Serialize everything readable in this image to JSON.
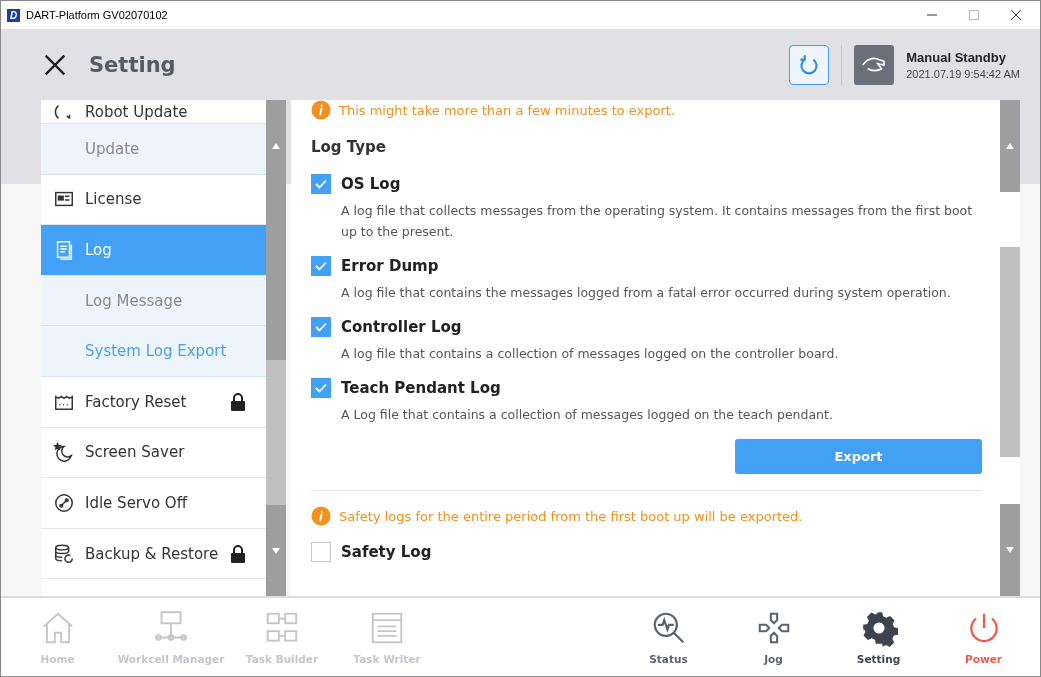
{
  "window": {
    "logo": "D",
    "title": "DART-Platform GV02070102"
  },
  "header": {
    "title": "Setting",
    "status": "Manual Standby",
    "datetime": "2021.07.19 9:54:42 AM"
  },
  "sidebar": {
    "items": [
      {
        "label": "Robot Update",
        "kind": "item",
        "selected": false,
        "locked": false
      },
      {
        "label": "Update",
        "kind": "sub",
        "selected": false,
        "locked": false
      },
      {
        "label": "License",
        "kind": "item",
        "selected": false,
        "locked": false
      },
      {
        "label": "Log",
        "kind": "item",
        "selected": true,
        "locked": false
      },
      {
        "label": "Log Message",
        "kind": "sub",
        "selected": false,
        "locked": false
      },
      {
        "label": "System Log Export",
        "kind": "sub",
        "selected": true,
        "locked": false
      },
      {
        "label": "Factory Reset",
        "kind": "item",
        "selected": false,
        "locked": true
      },
      {
        "label": "Screen Saver",
        "kind": "item",
        "selected": false,
        "locked": false
      },
      {
        "label": "Idle Servo Off",
        "kind": "item",
        "selected": false,
        "locked": false
      },
      {
        "label": "Backup & Restore",
        "kind": "item",
        "selected": false,
        "locked": true
      }
    ]
  },
  "content": {
    "notice": "This might take more than a few minutes to export.",
    "section_title": "Log Type",
    "logs": [
      {
        "title": "OS Log",
        "description": "A log file that collects messages from the operating system. It contains messages from the first boot up to the present.",
        "checked": true
      },
      {
        "title": "Error Dump",
        "description": "A log file that contains the messages logged from a fatal error occurred during system operation.",
        "checked": true
      },
      {
        "title": "Controller Log",
        "description": "A log file that contains a collection of messages logged on the controller board.",
        "checked": true
      },
      {
        "title": "Teach Pendant Log",
        "description": "A Log file that contains a collection of messages logged on the teach pendant.",
        "checked": true
      }
    ],
    "export_button": "Export",
    "safety_notice": "Safety logs for the entire period from the first boot up will be exported.",
    "safety_log": {
      "title": "Safety Log",
      "checked": false
    }
  },
  "nav": [
    {
      "label": "Home",
      "kind": "home",
      "disabled": true,
      "selected": false
    },
    {
      "label": "Workcell Manager",
      "kind": "workcell",
      "disabled": true,
      "selected": false
    },
    {
      "label": "Task Builder",
      "kind": "builder",
      "disabled": true,
      "selected": false
    },
    {
      "label": "Task Writer",
      "kind": "writer",
      "disabled": true,
      "selected": false
    },
    {
      "label": "Status",
      "kind": "status",
      "disabled": false,
      "selected": false
    },
    {
      "label": "Jog",
      "kind": "jog",
      "disabled": false,
      "selected": false
    },
    {
      "label": "Setting",
      "kind": "setting",
      "disabled": false,
      "selected": true
    },
    {
      "label": "Power",
      "kind": "power",
      "disabled": false,
      "selected": false
    }
  ]
}
